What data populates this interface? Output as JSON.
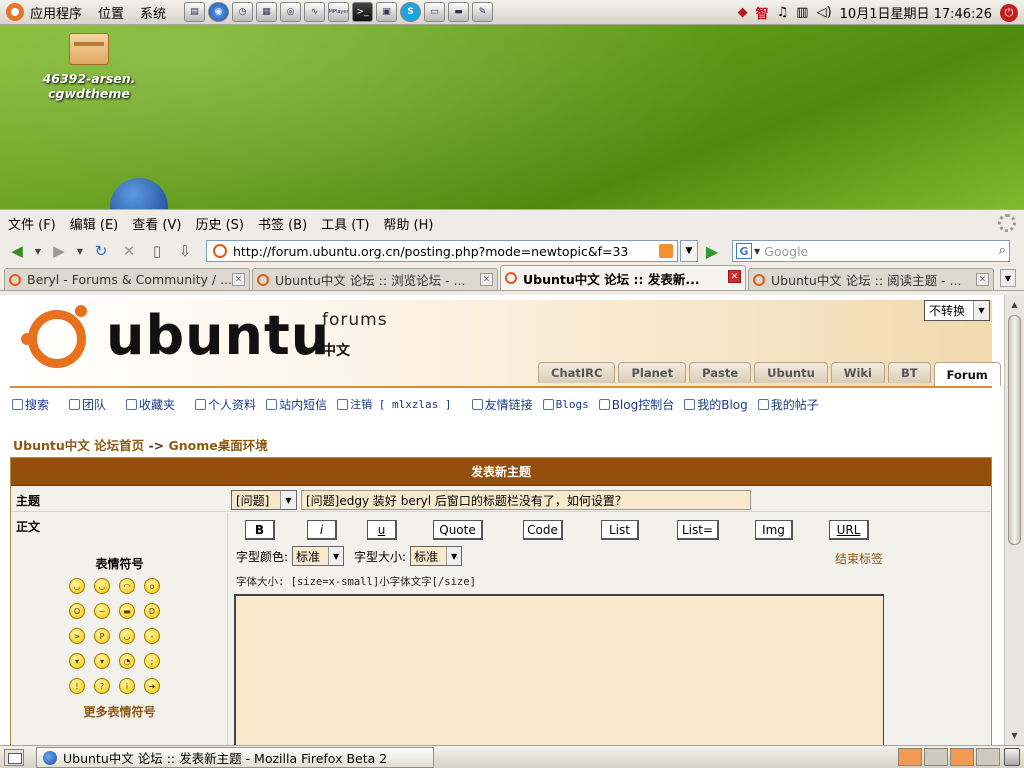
{
  "top_panel": {
    "menus": [
      "应用程序",
      "位置",
      "系统"
    ],
    "launchers": [
      "terminal-icon",
      "globe-icon",
      "clock-icon",
      "calculator-icon",
      "music-icon",
      "monitor-icon",
      "mplayer-icon",
      "console-icon",
      "notes-icon",
      "skype-icon",
      "window-icon",
      "desktop-icon",
      "editor-icon"
    ],
    "launcher_labels": [
      "MPlayer"
    ],
    "tray_chinese": "智",
    "datetime": "10月1日星期日 17:46:26"
  },
  "desktop": {
    "icon_label_line1": "46392-arsen.",
    "icon_label_line2": "cgwdtheme"
  },
  "browser": {
    "menu": [
      "文件 (F)",
      "编辑 (E)",
      "查看 (V)",
      "历史 (S)",
      "书签 (B)",
      "工具 (T)",
      "帮助 (H)"
    ],
    "url": "http://forum.ubuntu.org.cn/posting.php?mode=newtopic&f=33",
    "search_placeholder": "Google",
    "tabs": [
      {
        "label": "Beryl - Forums & Community / ...",
        "active": false
      },
      {
        "label": "Ubuntu中文 论坛 :: 浏览论坛 - ...",
        "active": false
      },
      {
        "label": "Ubuntu中文 论坛 :: 发表新...",
        "active": true
      },
      {
        "label": "Ubuntu中文 论坛 :: 阅读主题 - ...",
        "active": false
      }
    ]
  },
  "forum": {
    "brand": "ubuntu",
    "brand_sub": "forums",
    "brand_cn": "中文",
    "lang_select": "不转换",
    "site_tabs": [
      "ChatIRC",
      "Planet",
      "Paste",
      "Ubuntu",
      "Wiki",
      "BT",
      "Forum"
    ],
    "active_site_tab": "Forum",
    "nav": [
      "搜索",
      "团队",
      "收藏夹",
      "个人资料",
      "站内短信",
      "注销 [ mlxzlas ]",
      "友情链接",
      "Blogs",
      "Blog控制台",
      "我的Blog",
      "我的帖子"
    ],
    "breadcrumb_home": "Ubuntu中文 论坛首页",
    "breadcrumb_sep": "->",
    "breadcrumb_forum": "Gnome桌面环境",
    "post_title": "发表新主题",
    "subject_label": "主题",
    "prefix_value": "[问题]",
    "subject_value": "[问题]edgy 装好 beryl 后窗口的标题栏没有了，如何设置？",
    "body_label": "正文",
    "smilies_title": "表情符号",
    "more_smilies": "更多表情符号",
    "bbcode_buttons": [
      "B",
      "i",
      "u",
      "Quote",
      "Code",
      "List",
      "List=",
      "Img",
      "URL"
    ],
    "font_color_label": "字型颜色:",
    "font_color_value": "标准",
    "font_size_label": "字型大小:",
    "font_size_value": "标准",
    "close_tags": "结束标签",
    "help_line": "字体大小: [size=x-small]小字体文字[/size]"
  },
  "bottom_panel": {
    "task_label": "Ubuntu中文 论坛 :: 发表新主题 - Mozilla Firefox Beta 2"
  }
}
